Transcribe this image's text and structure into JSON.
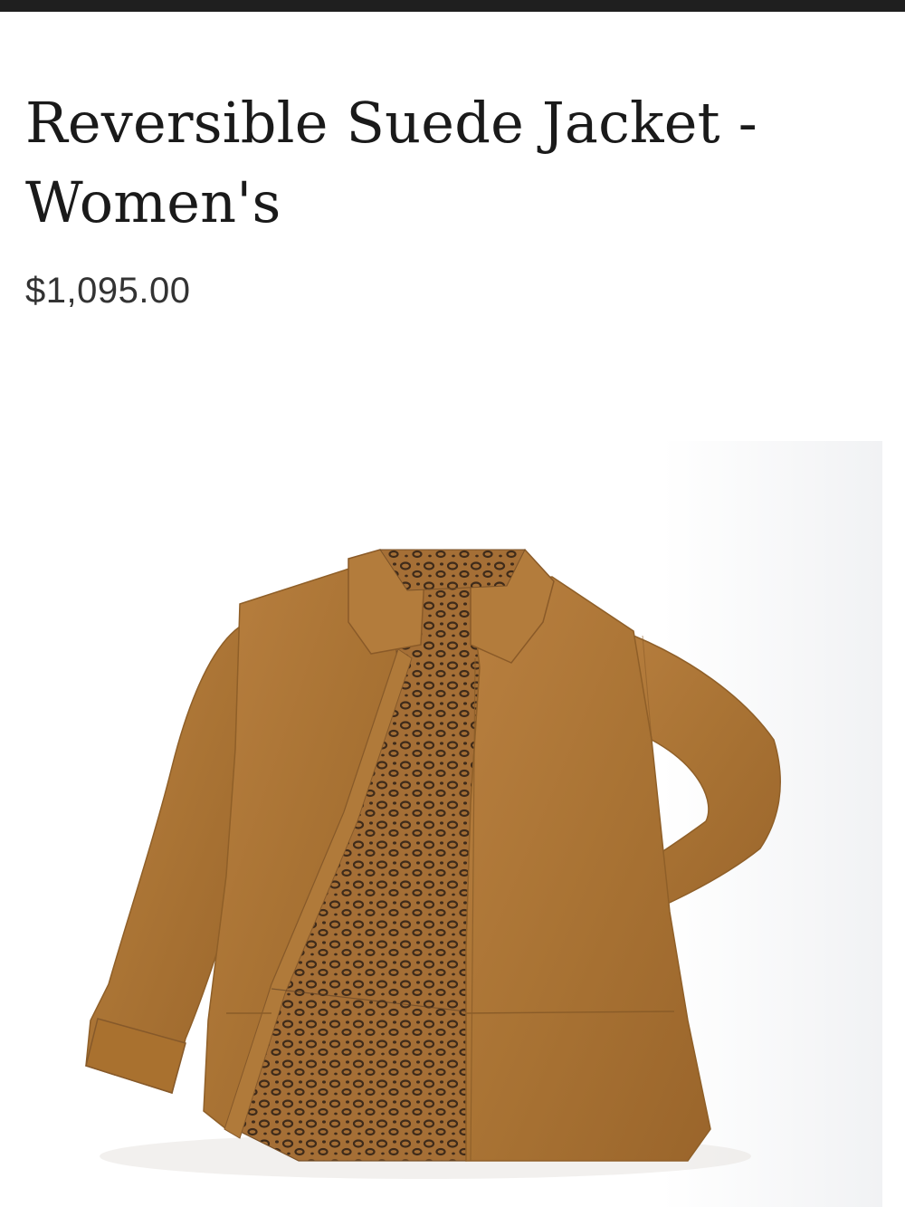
{
  "product": {
    "title": "Reversible Suede Jacket - Women's",
    "price": "$1,095.00",
    "image_subject": "jacket-photo"
  },
  "colors": {
    "top_bar": "#1f1f1f",
    "suede": "#b07a3a",
    "suede_shadow": "#8f5f28",
    "leopard_base": "#a06a32",
    "leopard_spot": "#4a3420"
  }
}
